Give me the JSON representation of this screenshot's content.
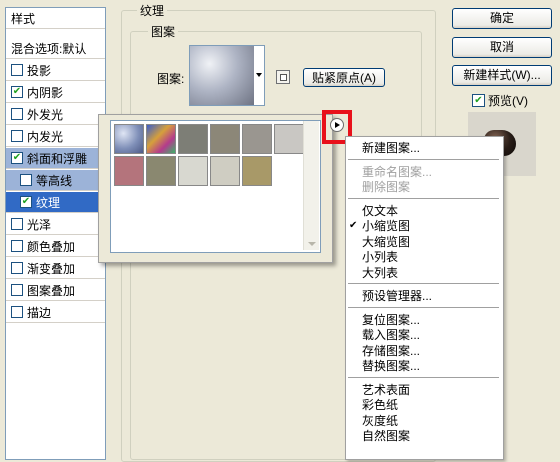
{
  "styles_panel": {
    "header": "样式",
    "blend_options": "混合选项:默认",
    "items": [
      {
        "label": "投影",
        "checked": false
      },
      {
        "label": "内阴影",
        "checked": true
      },
      {
        "label": "外发光",
        "checked": false
      },
      {
        "label": "内发光",
        "checked": false
      },
      {
        "label": "斜面和浮雕",
        "checked": true
      },
      {
        "label": "等高线",
        "checked": false
      },
      {
        "label": "纹理",
        "checked": true
      },
      {
        "label": "光泽",
        "checked": false
      },
      {
        "label": "颜色叠加",
        "checked": false
      },
      {
        "label": "渐变叠加",
        "checked": false
      },
      {
        "label": "图案叠加",
        "checked": false
      },
      {
        "label": "描边",
        "checked": false
      }
    ]
  },
  "texture_group": {
    "title": "纹理",
    "pattern_group_title": "图案",
    "pattern_label": "图案:",
    "snap_origin_button": "贴紧原点(A)"
  },
  "buttons": {
    "ok": "确定",
    "cancel": "取消",
    "new_style": "新建样式(W)...",
    "preview_label": "预览(V)",
    "preview_checked": true
  },
  "swatches": [
    {
      "name": "bubbles",
      "color": "#8e9cbf"
    },
    {
      "name": "tie-dye",
      "color": "#c9863b"
    },
    {
      "name": "stone-1",
      "color": "#7d7e76"
    },
    {
      "name": "stone-2",
      "color": "#8c8778"
    },
    {
      "name": "stone-3",
      "color": "#9a9690"
    },
    {
      "name": "granite",
      "color": "#c9c7c3"
    },
    {
      "name": "red-rock",
      "color": "#b4747c"
    },
    {
      "name": "gravel",
      "color": "#8a8870"
    },
    {
      "name": "light-stone",
      "color": "#d8d8d0"
    },
    {
      "name": "paper",
      "color": "#cfcdc2"
    },
    {
      "name": "sand",
      "color": "#a89968"
    }
  ],
  "menu": {
    "items": [
      {
        "label": "新建图案...",
        "enabled": true,
        "checked": false
      },
      {
        "sep": true
      },
      {
        "label": "重命名图案...",
        "enabled": false,
        "checked": false
      },
      {
        "label": "删除图案",
        "enabled": false,
        "checked": false
      },
      {
        "sep": true
      },
      {
        "label": "仅文本",
        "enabled": true,
        "checked": false
      },
      {
        "label": "小缩览图",
        "enabled": true,
        "checked": true
      },
      {
        "label": "大缩览图",
        "enabled": true,
        "checked": false
      },
      {
        "label": "小列表",
        "enabled": true,
        "checked": false
      },
      {
        "label": "大列表",
        "enabled": true,
        "checked": false
      },
      {
        "sep": true
      },
      {
        "label": "预设管理器...",
        "enabled": true,
        "checked": false
      },
      {
        "sep": true
      },
      {
        "label": "复位图案...",
        "enabled": true,
        "checked": false
      },
      {
        "label": "载入图案...",
        "enabled": true,
        "checked": false
      },
      {
        "label": "存储图案...",
        "enabled": true,
        "checked": false
      },
      {
        "label": "替换图案...",
        "enabled": true,
        "checked": false
      },
      {
        "sep": true
      },
      {
        "label": "艺术表面",
        "enabled": true,
        "checked": false
      },
      {
        "label": "彩色纸",
        "enabled": true,
        "checked": false
      },
      {
        "label": "灰度纸",
        "enabled": true,
        "checked": false
      },
      {
        "label": "自然图案",
        "enabled": true,
        "checked": false
      }
    ]
  },
  "colors": {
    "highlight_red": "#e8111b",
    "selection_blue": "#316ac5",
    "check_green": "#21a121"
  }
}
